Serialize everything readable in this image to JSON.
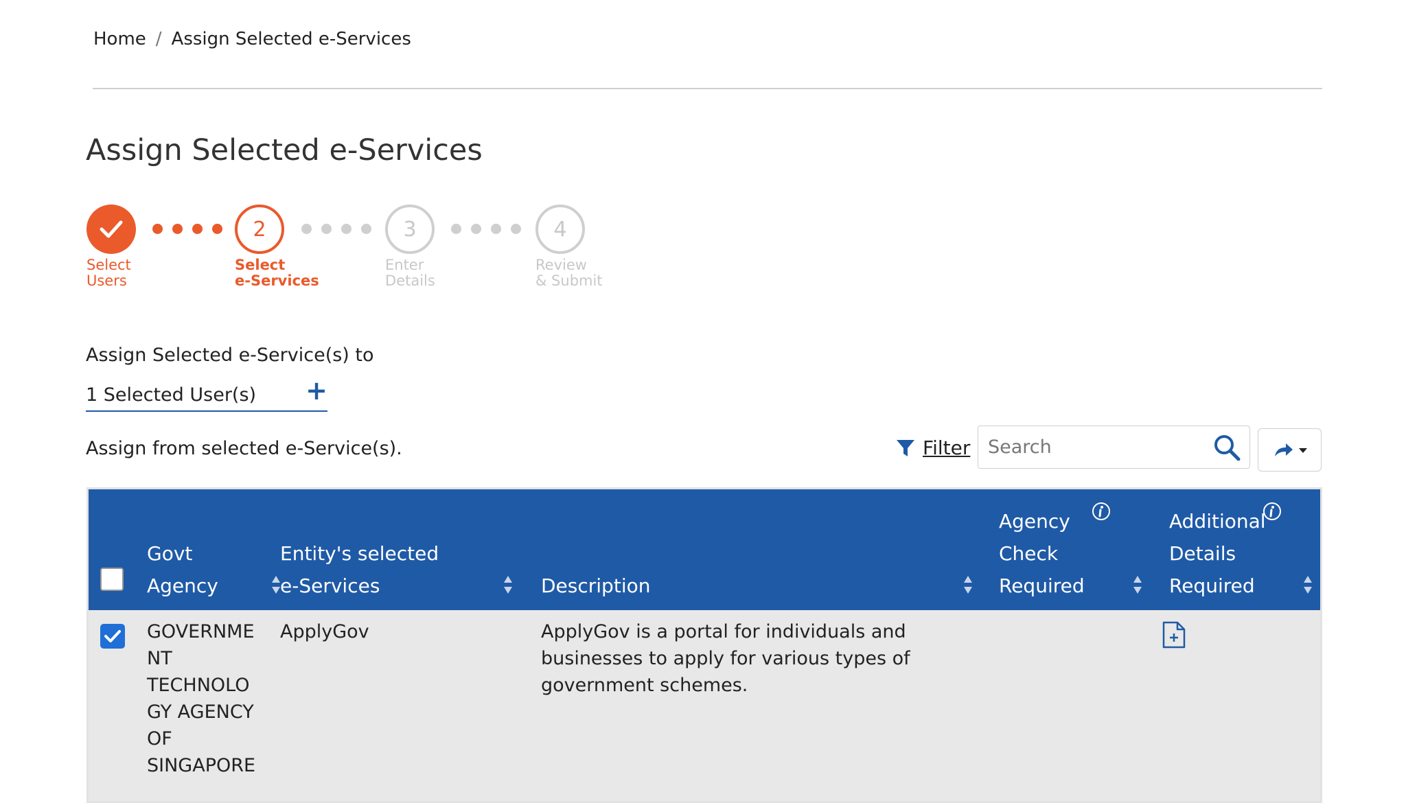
{
  "breadcrumb": {
    "home": "Home",
    "separator": "/",
    "current": "Assign Selected e-Services"
  },
  "page": {
    "title": "Assign Selected e-Services"
  },
  "stepper": {
    "steps": [
      {
        "number": "",
        "line1": "Select",
        "line2": "Users",
        "state": "done"
      },
      {
        "number": "2",
        "line1": "Select",
        "line2": "e-Services",
        "state": "current"
      },
      {
        "number": "3",
        "line1": "Enter",
        "line2": "Details",
        "state": "todo"
      },
      {
        "number": "4",
        "line1": "Review",
        "line2": "& Submit",
        "state": "todo"
      }
    ]
  },
  "assign": {
    "label": "Assign Selected e-Service(s) to",
    "selected_users": "1 Selected User(s)",
    "from_label": "Assign from selected e-Service(s)."
  },
  "toolbar": {
    "filter_label": "Filter",
    "search_placeholder": "Search",
    "search_value": ""
  },
  "table": {
    "headers": {
      "agency_line1": "Govt",
      "agency_line2": "Agency",
      "eservices_line1": "Entity's selected",
      "eservices_line2": "e-Services",
      "description": "Description",
      "check_line1": "Agency",
      "check_line2": "Check",
      "check_line3": "Required",
      "details_line1": "Additional",
      "details_line2": "Details",
      "details_line3": "Required"
    },
    "rows": [
      {
        "checked": true,
        "agency_lines": [
          "GOVERNME",
          "NT",
          "TECHNOLO",
          "GY AGENCY",
          "OF",
          "SINGAPORE"
        ],
        "eservice": "ApplyGov",
        "description_lines": [
          "ApplyGov is a portal for individuals and",
          "businesses to apply for various types of",
          "government schemes."
        ],
        "agency_check_required": "",
        "additional_details_icon": "document-plus-icon"
      }
    ]
  },
  "colors": {
    "primary": "#1f5aa6",
    "accent": "#ea5a2b",
    "inactive": "#c8c8c8",
    "row_bg": "#e8e8e8"
  }
}
